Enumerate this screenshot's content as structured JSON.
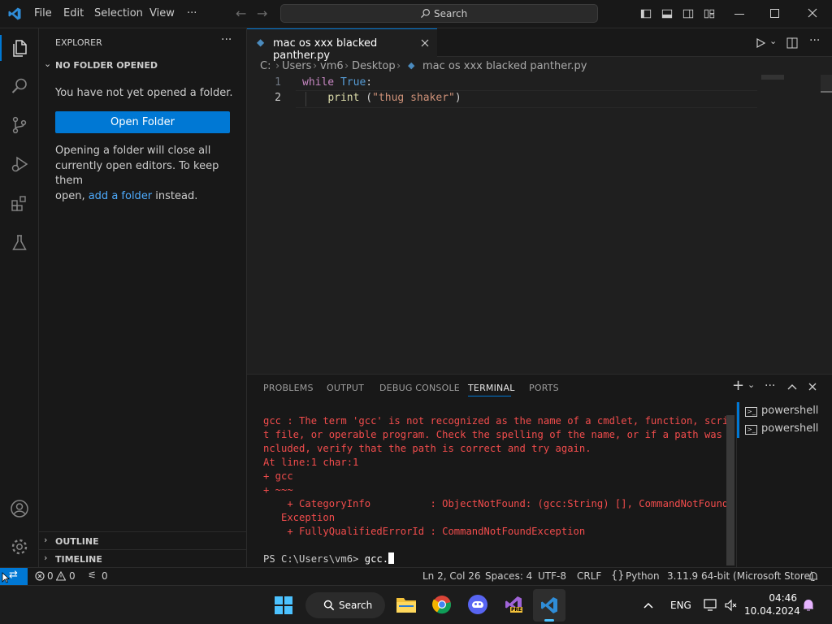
{
  "titlebar": {
    "menu": [
      "File",
      "Edit",
      "Selection",
      "View",
      "···"
    ],
    "search_placeholder": "Search"
  },
  "sidebar": {
    "title": "EXPLORER",
    "section": "NO FOLDER OPENED",
    "message": "You have not yet opened a folder.",
    "open_folder": "Open Folder",
    "info_line1": "Opening a folder will close all",
    "info_line2": "currently open editors. To keep them",
    "info_line3_pre": "open, ",
    "info_link": "add a folder",
    "info_line3_post": " instead.",
    "outline": "OUTLINE",
    "timeline": "TIMELINE"
  },
  "editor": {
    "tab_label": "mac os xxx blacked panther.py",
    "breadcrumb": [
      "C:",
      "Users",
      "vm6",
      "Desktop",
      "mac os xxx blacked panther.py"
    ],
    "lines": [
      {
        "num": "1",
        "kw": "while",
        "val": "True",
        "rest": ":"
      },
      {
        "num": "2",
        "indent": "    ",
        "fn": "print",
        "paren_open": " (",
        "str": "\"thug shaker\"",
        "paren_close": ")"
      }
    ]
  },
  "panel": {
    "tabs": [
      "PROBLEMS",
      "OUTPUT",
      "DEBUG CONSOLE",
      "TERMINAL",
      "PORTS"
    ],
    "active_tab": "TERMINAL",
    "terminal_lines": [
      "gcc : The term 'gcc' is not recognized as the name of a cmdlet, function, scrip",
      "t file, or operable program. Check the spelling of the name, or if a path was i",
      "ncluded, verify that the path is correct and try again.",
      "At line:1 char:1",
      "+ gcc",
      "+ ~~~",
      "    + CategoryInfo          : ObjectNotFound: (gcc:String) [], CommandNotFound",
      "   Exception",
      "    + FullyQualifiedErrorId : CommandNotFoundException"
    ],
    "prompt": "PS C:\\Users\\vm6> ",
    "command": "gcc.",
    "shells": [
      "powershell",
      "powershell"
    ]
  },
  "statusbar": {
    "errors": "0",
    "warnings": "0",
    "ports": "0",
    "position": "Ln 2, Col 26",
    "spaces": "Spaces: 4",
    "encoding": "UTF-8",
    "eol": "CRLF",
    "language": "Python",
    "interpreter": "3.11.9 64-bit (Microsoft Store)"
  },
  "taskbar": {
    "search": "Search",
    "language": "ENG",
    "time": "04:46",
    "date": "10.04.2024",
    "vs_badge": "PRE"
  },
  "colors": {
    "accent": "#0078d4",
    "error_text": "#f14c4c",
    "keyword": "#c586c0",
    "constant": "#569cd6",
    "function": "#dcdcaa",
    "string": "#ce9178",
    "link": "#4daafc"
  }
}
